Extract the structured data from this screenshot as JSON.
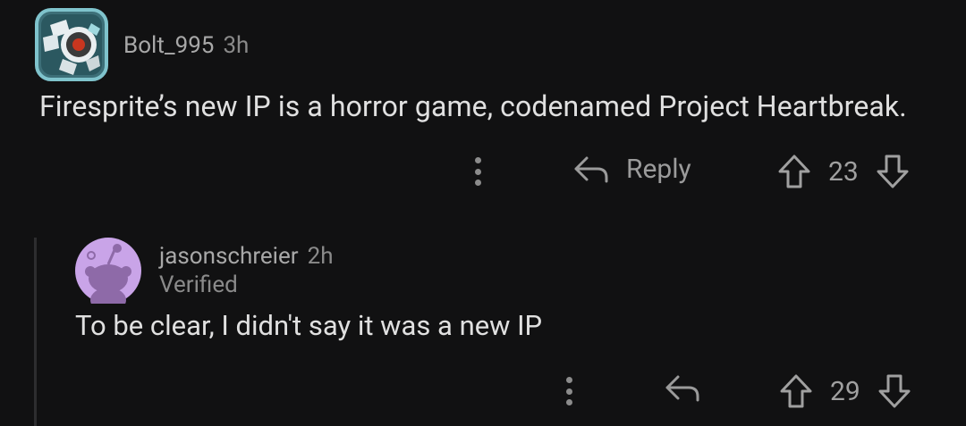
{
  "top_comment": {
    "username": "Bolt_995",
    "time": "3h",
    "body": "Firesprite’s new IP is a horror game, codenamed Project Heartbreak.",
    "reply_label": "Reply",
    "score": "23",
    "icons": {
      "avatar": "robot-avatar-icon",
      "more": "more-vertical-icon",
      "reply": "reply-arrow-icon",
      "upvote": "upvote-arrow-icon",
      "downvote": "downvote-arrow-icon"
    }
  },
  "reply_comment": {
    "username": "jasonschreier",
    "time": "2h",
    "flair": "Verified",
    "body": "To be clear, I didn't say it was a new IP",
    "score": "29",
    "icons": {
      "avatar": "reddit-snoo-avatar-icon",
      "more": "more-vertical-icon",
      "reply": "reply-arrow-icon",
      "upvote": "upvote-arrow-icon",
      "downvote": "downvote-arrow-icon"
    }
  },
  "colors": {
    "background": "#111112",
    "text": "#e0e0e0",
    "muted": "#8a8a8a",
    "avatar_reply_bg": "#c9a4e8"
  }
}
